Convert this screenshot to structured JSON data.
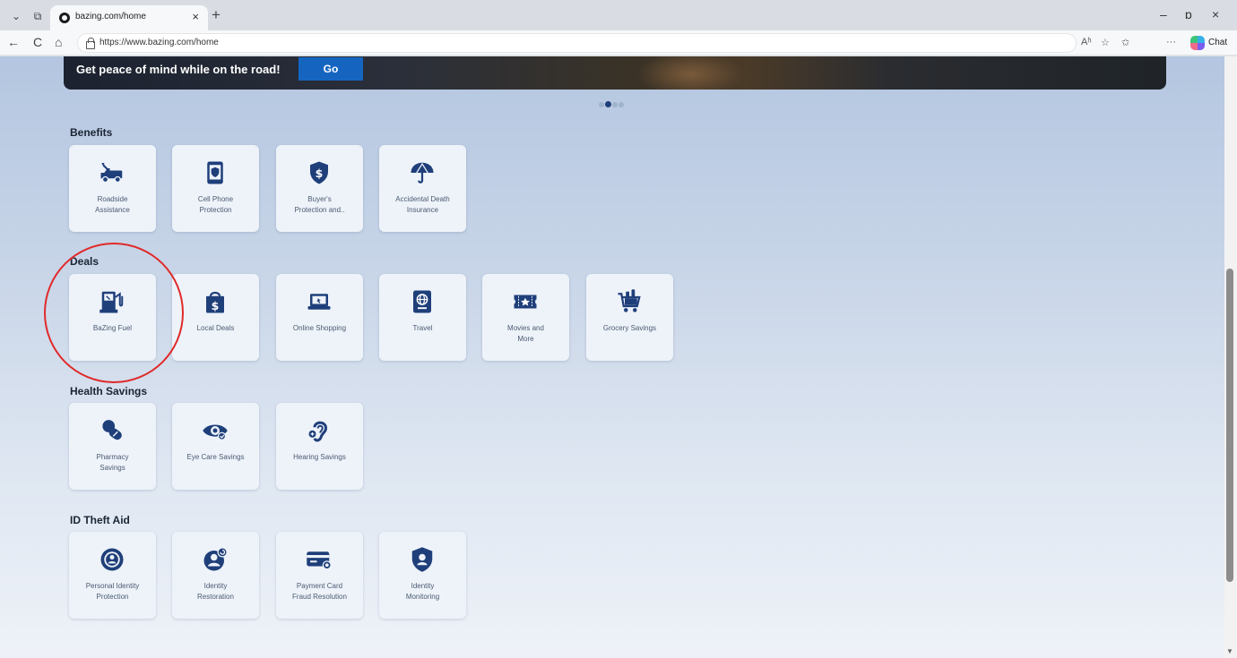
{
  "browser": {
    "tab_title": "bazing.com/home",
    "tab_close": "×",
    "new_tab": "+",
    "url": "https://www.bazing.com/home",
    "chat_label": "Chat",
    "minimize": "–",
    "restore": "ɒ",
    "close": "×",
    "back": "←",
    "refresh": "C",
    "home": "⌂",
    "tab_menu": "⌄",
    "tab_actions": "⧉",
    "read_aloud": "Aʱ",
    "favorite": "☆",
    "favorites": "✩",
    "more": "···"
  },
  "banner": {
    "text": "Get peace of mind while on the road!",
    "button": "Go"
  },
  "carousel": {
    "count": 4,
    "active": 1
  },
  "sections": [
    {
      "title": "Benefits",
      "items": [
        {
          "label": "Roadside\nAssistance",
          "icon": "tow-truck-icon"
        },
        {
          "label": "Cell Phone\nProtection",
          "icon": "phone-shield-icon"
        },
        {
          "label": "Buyer's\nProtection and..",
          "icon": "shield-dollar-icon"
        },
        {
          "label": "Accidental Death\nInsurance",
          "icon": "umbrella-icon"
        }
      ]
    },
    {
      "title": "Deals",
      "items": [
        {
          "label": "BaZing Fuel",
          "icon": "gas-pump-icon"
        },
        {
          "label": "Local Deals",
          "icon": "shopping-bag-icon"
        },
        {
          "label": "Online Shopping",
          "icon": "laptop-icon"
        },
        {
          "label": "Travel",
          "icon": "passport-icon"
        },
        {
          "label": "Movies and\nMore",
          "icon": "ticket-icon"
        },
        {
          "label": "Grocery Savings",
          "icon": "grocery-cart-icon"
        }
      ]
    },
    {
      "title": "Health Savings",
      "items": [
        {
          "label": "Pharmacy\nSavings",
          "icon": "pills-icon"
        },
        {
          "label": "Eye Care Savings",
          "icon": "eye-icon"
        },
        {
          "label": "Hearing Savings",
          "icon": "ear-icon"
        }
      ]
    },
    {
      "title": "ID Theft Aid",
      "items": [
        {
          "label": "Personal Identity\nProtection",
          "icon": "identity-target-icon"
        },
        {
          "label": "Identity\nRestoration",
          "icon": "user-restore-icon"
        },
        {
          "label": "Payment Card\nFraud Resolution",
          "icon": "credit-card-icon"
        },
        {
          "label": "Identity\nMonitoring",
          "icon": "user-shield-icon"
        }
      ]
    }
  ],
  "colors": {
    "icon": "#1f3f7a",
    "accent": "#1565c0",
    "highlight": "#e02a2a"
  }
}
